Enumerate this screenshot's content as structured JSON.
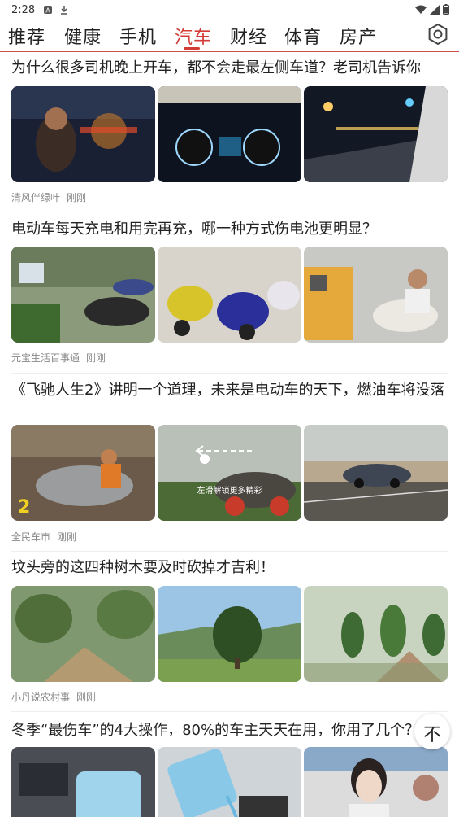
{
  "status_bar": {
    "time": "2:28"
  },
  "tabs": [
    "推荐",
    "健康",
    "手机",
    "汽车",
    "财经",
    "体育",
    "房产"
  ],
  "active_tab": "汽车",
  "articles": [
    {
      "title": "为什么很多司机晚上开车，都不会走最左侧车道？老司机告诉你",
      "source": "清风伴绿叶",
      "time": "刚刚",
      "images": [
        "driver-at-night",
        "dashboard-gauges",
        "night-road"
      ]
    },
    {
      "title": "电动车每天充电和用完再充，哪一种方式伤电池更明显？",
      "source": "元宝生活百事通",
      "time": "刚刚",
      "images": [
        "parked-scooters",
        "scooters-showroom",
        "charging-station"
      ]
    },
    {
      "title": "《飞驰人生2》讲明一个道理，未来是电动车的天下，燃油车将没落",
      "source": "全民车市",
      "time": "刚刚",
      "images": [
        "movie-poster",
        "rally-car",
        "bmw-sedan"
      ],
      "swipe_hint": "左滑解锁更多精彩"
    },
    {
      "title": "坟头旁的这四种树木要及时砍掉才吉利！",
      "source": "小丹说农村事",
      "time": "刚刚",
      "images": [
        "trees-by-mound",
        "single-tree-hill",
        "tree-rows"
      ]
    },
    {
      "title": "冬季“最伤车”的4大操作，80%的车主天天在用，你用了几个？",
      "images": [
        "washer-fluid-bottle",
        "pouring-fluid",
        "woman-portrait"
      ]
    }
  ],
  "scroll_top_button": "不",
  "colors": {
    "accent": "#d33c36",
    "meta_text": "#888888"
  }
}
